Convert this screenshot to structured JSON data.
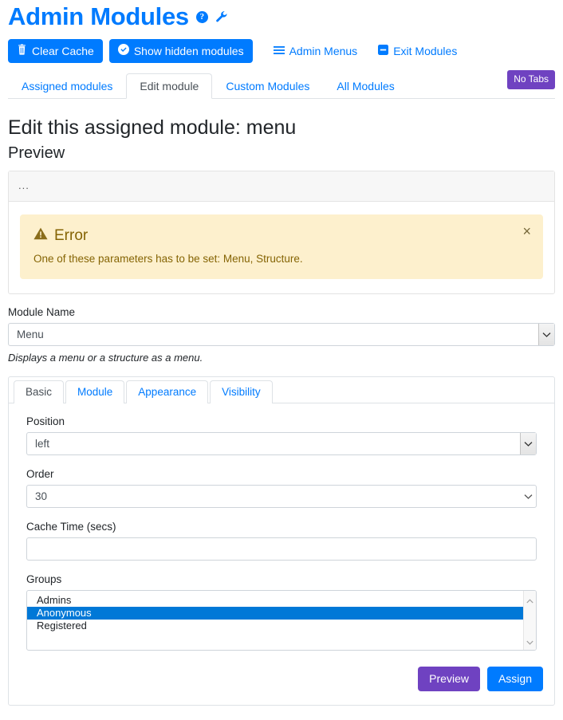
{
  "header": {
    "title": "Admin Modules",
    "help_icon": "question-circle-icon",
    "wrench_icon": "wrench-icon"
  },
  "toolbar": {
    "clear_cache_label": "Clear Cache",
    "show_hidden_label": "Show hidden modules",
    "admin_menus_label": "Admin Menus",
    "exit_modules_label": "Exit Modules"
  },
  "tabs": {
    "items": [
      {
        "label": "Assigned modules",
        "active": false
      },
      {
        "label": "Edit module",
        "active": true
      },
      {
        "label": "Custom Modules",
        "active": false
      },
      {
        "label": "All Modules",
        "active": false
      }
    ],
    "badge_label": "No Tabs"
  },
  "page": {
    "edit_title": "Edit this assigned module: menu",
    "preview_title": "Preview"
  },
  "preview_card": {
    "head_text": "...",
    "alert": {
      "heading": "Error",
      "message": "One of these parameters has to be set: Menu, Structure.",
      "close_label": "×"
    }
  },
  "module_name": {
    "label": "Module Name",
    "value": "Menu",
    "help": "Displays a menu or a structure as a menu."
  },
  "panel": {
    "tabs": [
      {
        "label": "Basic",
        "active": true
      },
      {
        "label": "Module",
        "active": false
      },
      {
        "label": "Appearance",
        "active": false
      },
      {
        "label": "Visibility",
        "active": false
      }
    ],
    "fields": {
      "position_label": "Position",
      "position_value": "left",
      "order_label": "Order",
      "order_value": "30",
      "cache_label": "Cache Time (secs)",
      "cache_value": "",
      "cache_placeholder": "",
      "groups_label": "Groups",
      "groups": [
        {
          "label": "Admins",
          "selected": false
        },
        {
          "label": "Anonymous",
          "selected": true
        },
        {
          "label": "Registered",
          "selected": false
        }
      ]
    },
    "actions": {
      "preview_label": "Preview",
      "assign_label": "Assign"
    }
  },
  "colors": {
    "primary": "#007bff",
    "purple": "#6f42c1",
    "alert_bg": "#fdf0cd",
    "alert_text": "#856404",
    "selection": "#0078d7"
  }
}
